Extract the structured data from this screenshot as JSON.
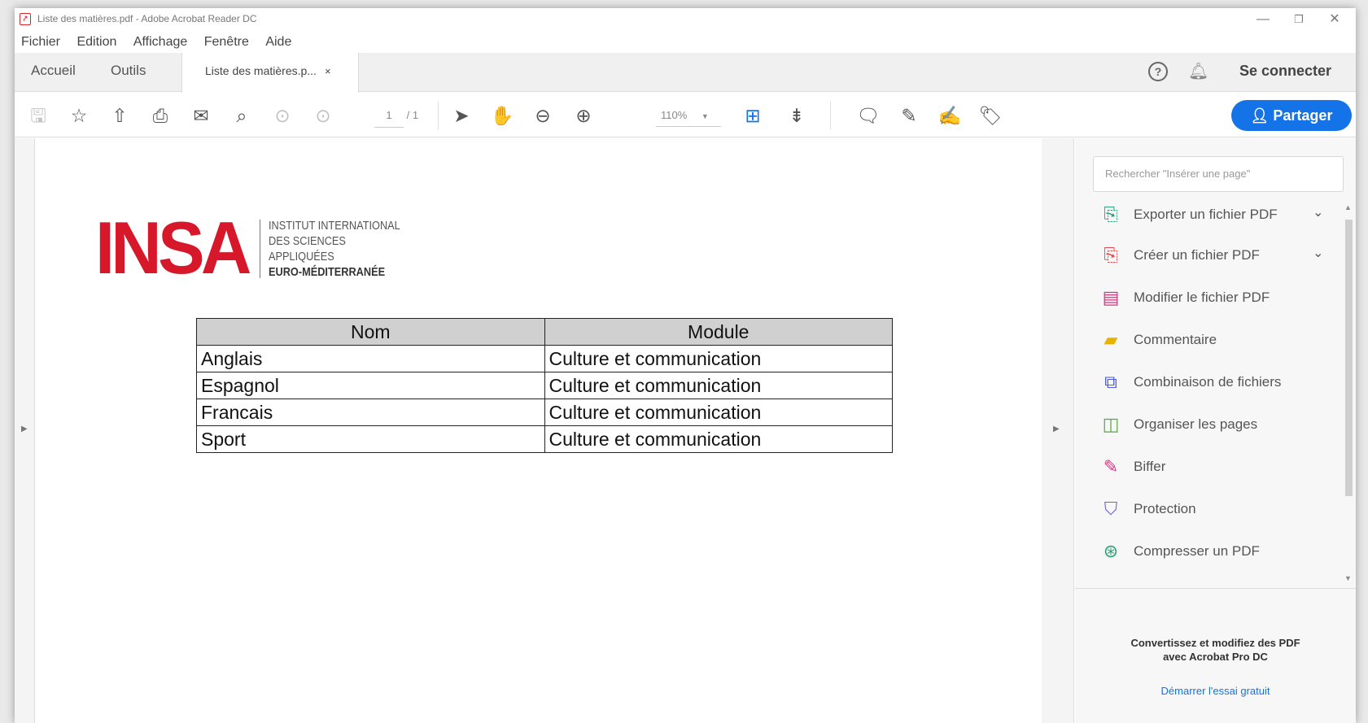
{
  "window": {
    "title": "Liste des matières.pdf - Adobe Acrobat Reader DC"
  },
  "menu": [
    "Fichier",
    "Edition",
    "Affichage",
    "Fenêtre",
    "Aide"
  ],
  "tabs": {
    "home": "Accueil",
    "tools": "Outils",
    "document": "Liste des matières.p...",
    "close": "×"
  },
  "header": {
    "signin": "Se connecter",
    "help": "?"
  },
  "toolbar": {
    "page_current": "1",
    "page_total": "/ 1",
    "zoom": "110%",
    "share": "Partager"
  },
  "document": {
    "logo": {
      "main": "INSA",
      "line1": "INSTITUT INTERNATIONAL",
      "line2": "DES SCIENCES",
      "line3": "APPLIQUÉES",
      "line4": "EURO-MÉDITERRANÉE"
    },
    "table": {
      "headers": [
        "Nom",
        "Module"
      ],
      "rows": [
        [
          "Anglais",
          "Culture et communication"
        ],
        [
          "Espagnol",
          "Culture et communication"
        ],
        [
          "Francais",
          "Culture et communication"
        ],
        [
          "Sport",
          "Culture et communication"
        ]
      ]
    }
  },
  "panel": {
    "search_placeholder": "Rechercher \"Insérer une page\"",
    "tools": [
      {
        "label": "Exporter un fichier PDF",
        "icon": "export-pdf-icon",
        "color": "#2d9d78"
      },
      {
        "label": "Créer un fichier PDF",
        "icon": "create-pdf-icon",
        "color": "#e34850"
      },
      {
        "label": "Modifier le fichier PDF",
        "icon": "edit-pdf-icon",
        "color": "#d5357d"
      },
      {
        "label": "Commentaire",
        "icon": "comment-icon",
        "color": "#e8b300"
      },
      {
        "label": "Combinaison de fichiers",
        "icon": "combine-icon",
        "color": "#4b5bdc"
      },
      {
        "label": "Organiser les pages",
        "icon": "organize-icon",
        "color": "#5aa843"
      },
      {
        "label": "Biffer",
        "icon": "redact-icon",
        "color": "#d5357d"
      },
      {
        "label": "Protection",
        "icon": "shield-icon",
        "color": "#6e63d8"
      },
      {
        "label": "Compresser un PDF",
        "icon": "compress-icon",
        "color": "#2d9d78"
      }
    ],
    "promo_line1": "Convertissez et modifiez des PDF",
    "promo_line2": "avec Acrobat Pro DC",
    "promo_link": "Démarrer l'essai gratuit"
  },
  "colors": {
    "accent": "#1473e6",
    "insa_red": "#d7182a"
  }
}
